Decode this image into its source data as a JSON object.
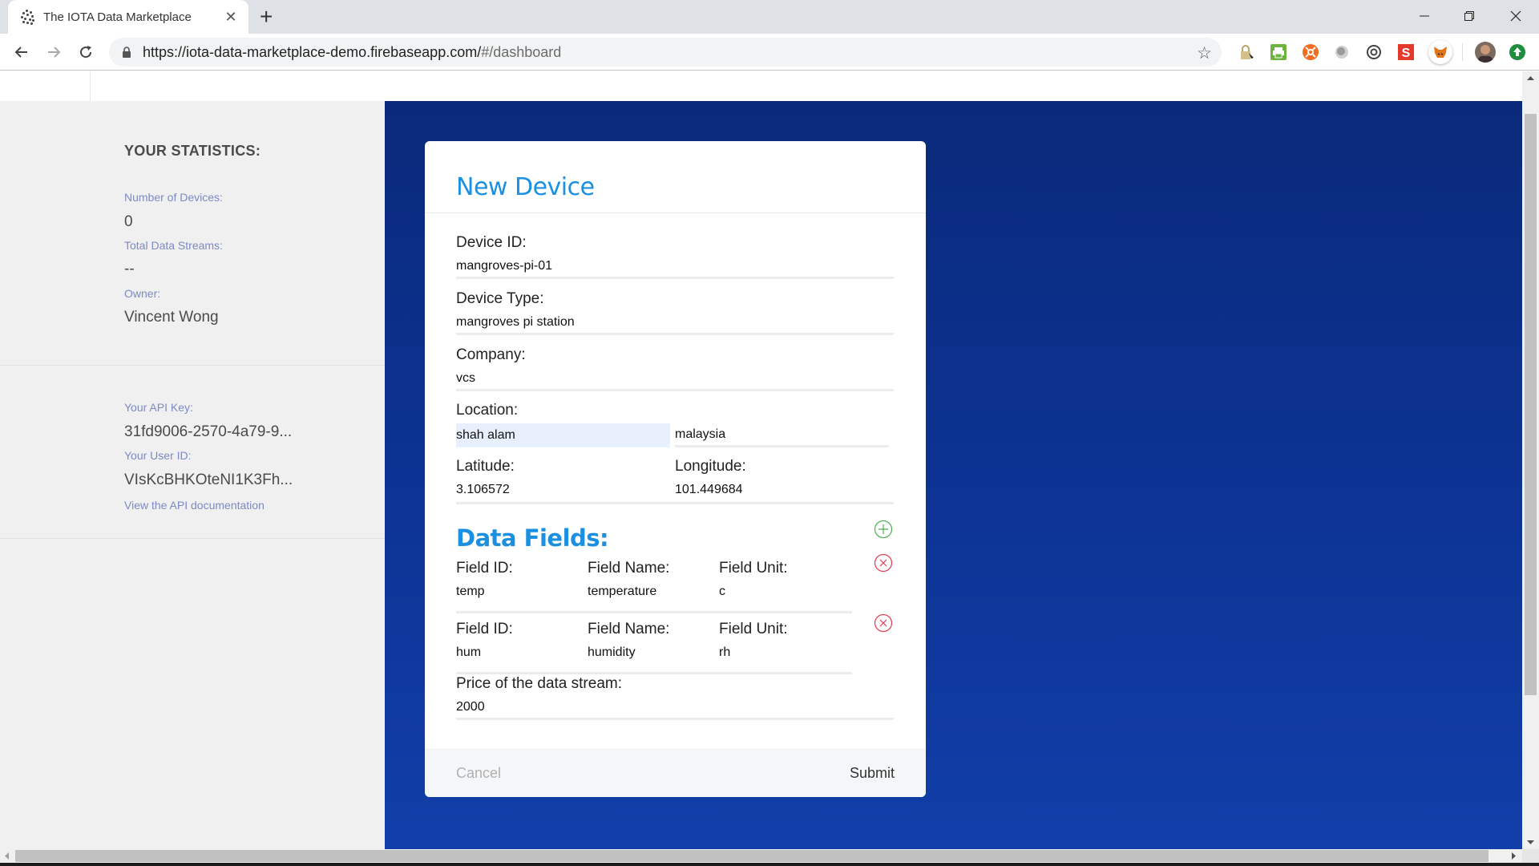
{
  "browser": {
    "tab_title": "The IOTA Data Marketplace",
    "url_main": "https://iota-data-marketplace-demo.firebaseapp.com/",
    "url_hash": "#/dashboard",
    "extensions": [
      "password-manager-icon",
      "print-friendly-icon",
      "orange-extension-icon",
      "grey-circle-icon",
      "openai-icon",
      "s-extension-icon",
      "metamask-fox-icon"
    ],
    "colors": {
      "tab_strip": "#dee1e6",
      "omnibox": "#f1f3f4"
    }
  },
  "sidebar": {
    "stats_heading": "YOUR STATISTICS:",
    "devices_label": "Number of Devices:",
    "devices_value": "0",
    "streams_label": "Total Data Streams:",
    "streams_value": "--",
    "owner_label": "Owner:",
    "owner_value": "Vincent Wong",
    "api_key_label": "Your API Key:",
    "api_key_value": "31fd9006-2570-4a79-9...",
    "user_id_label": "Your User ID:",
    "user_id_value": "VIsKcBHKOteNI1K3Fh...",
    "api_docs_link": "View the API documentation"
  },
  "modal": {
    "title": "New Device",
    "device_id": {
      "label": "Device ID:",
      "value": "mangroves-pi-01"
    },
    "device_type": {
      "label": "Device Type:",
      "value": "mangroves pi station"
    },
    "company": {
      "label": "Company:",
      "value": "vcs"
    },
    "location": {
      "label": "Location:",
      "city": "shah alam",
      "country": "malaysia"
    },
    "latitude": {
      "label": "Latitude:",
      "value": "3.106572"
    },
    "longitude": {
      "label": "Longitude:",
      "value": "101.449684"
    },
    "data_fields_title": "Data Fields:",
    "data_fields": [
      {
        "id_label": "Field ID:",
        "id": "temp",
        "name_label": "Field Name:",
        "name": "temperature",
        "unit_label": "Field Unit:",
        "unit": "c"
      },
      {
        "id_label": "Field ID:",
        "id": "hum",
        "name_label": "Field Name:",
        "name": "humidity",
        "unit_label": "Field Unit:",
        "unit": "rh"
      }
    ],
    "price": {
      "label": "Price of the data stream:",
      "value": "2000"
    },
    "cancel_label": "Cancel",
    "submit_label": "Submit",
    "colors": {
      "accent": "#1b8fe0",
      "add": "#4caf50",
      "remove": "#e53950"
    }
  },
  "theme": {
    "bg_top": "#0a297a",
    "bg_bottom": "#113ea9",
    "sidebar_bg": "#f0f0f0",
    "sidebar_label": "#7c8ac2"
  }
}
